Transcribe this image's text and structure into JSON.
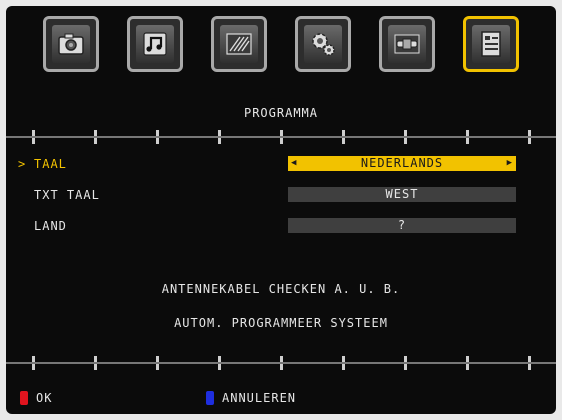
{
  "toolbar": {
    "tabs": [
      {
        "icon": "camera-icon",
        "active": false
      },
      {
        "icon": "music-note-icon",
        "active": false
      },
      {
        "icon": "picture-settings-icon",
        "active": false
      },
      {
        "icon": "gears-icon",
        "active": false
      },
      {
        "icon": "connection-cable-icon",
        "active": false
      },
      {
        "icon": "document-icon",
        "active": true
      }
    ],
    "active_color": "#f2c200"
  },
  "menu": {
    "title": "PROGRAMMA",
    "selected_marker": ">",
    "rows": [
      {
        "label": "TAAL",
        "value": "NEDERLANDS",
        "selected": true
      },
      {
        "label": "TXT TAAL",
        "value": "WEST",
        "selected": false
      },
      {
        "label": "LAND",
        "value": "?",
        "selected": false
      }
    ]
  },
  "messages": {
    "line1": "ANTENNEKABEL CHECKEN A. U. B.",
    "line2": "AUTOM. PROGRAMMEER SYSTEEM"
  },
  "footer": {
    "ok": {
      "label": "OK",
      "color": "#e0141e"
    },
    "cancel": {
      "label": "ANNULEREN",
      "color": "#1e2ee0"
    }
  }
}
